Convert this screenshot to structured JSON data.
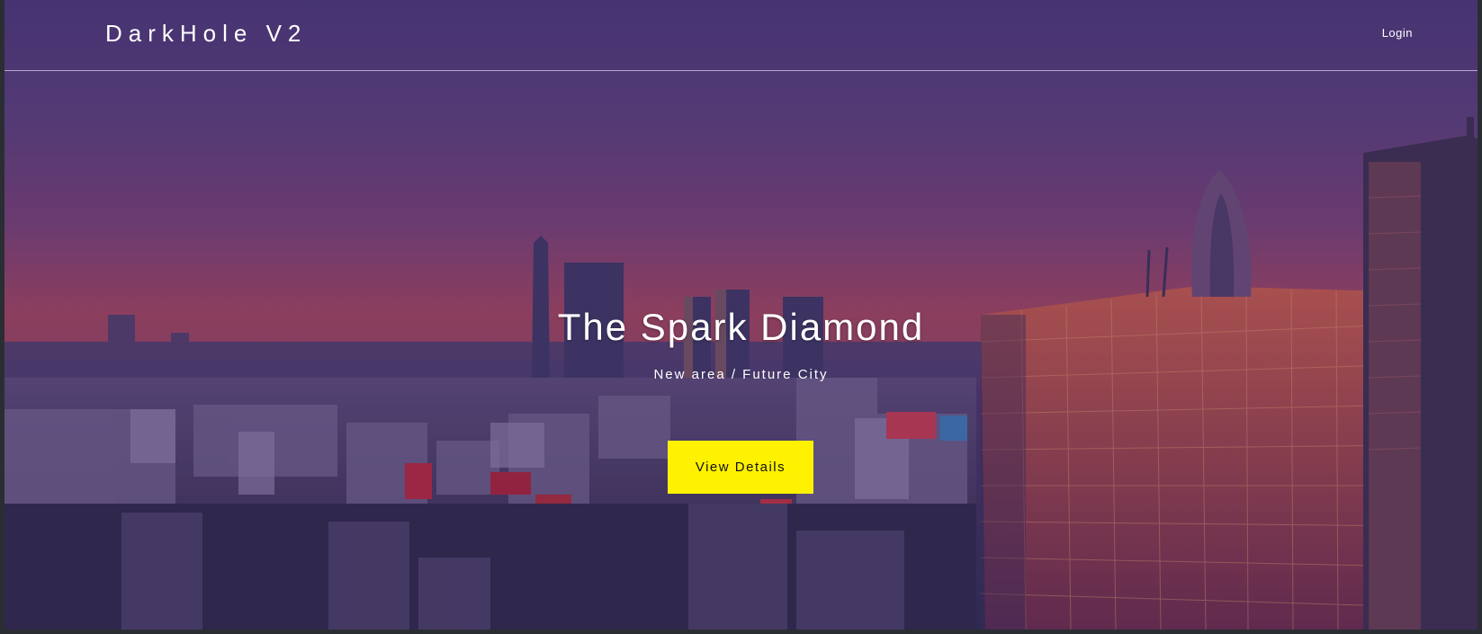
{
  "header": {
    "brand": "DarkHole V2",
    "login_label": "Login"
  },
  "hero": {
    "title": "The Spark Diamond",
    "subtitle": "New area / Future City",
    "cta_label": "View Details"
  },
  "colors": {
    "accent": "#fff200",
    "text": "#ffffff",
    "overlay": "#4a3573"
  },
  "icons": {
    "background": "city-skyline-image"
  }
}
